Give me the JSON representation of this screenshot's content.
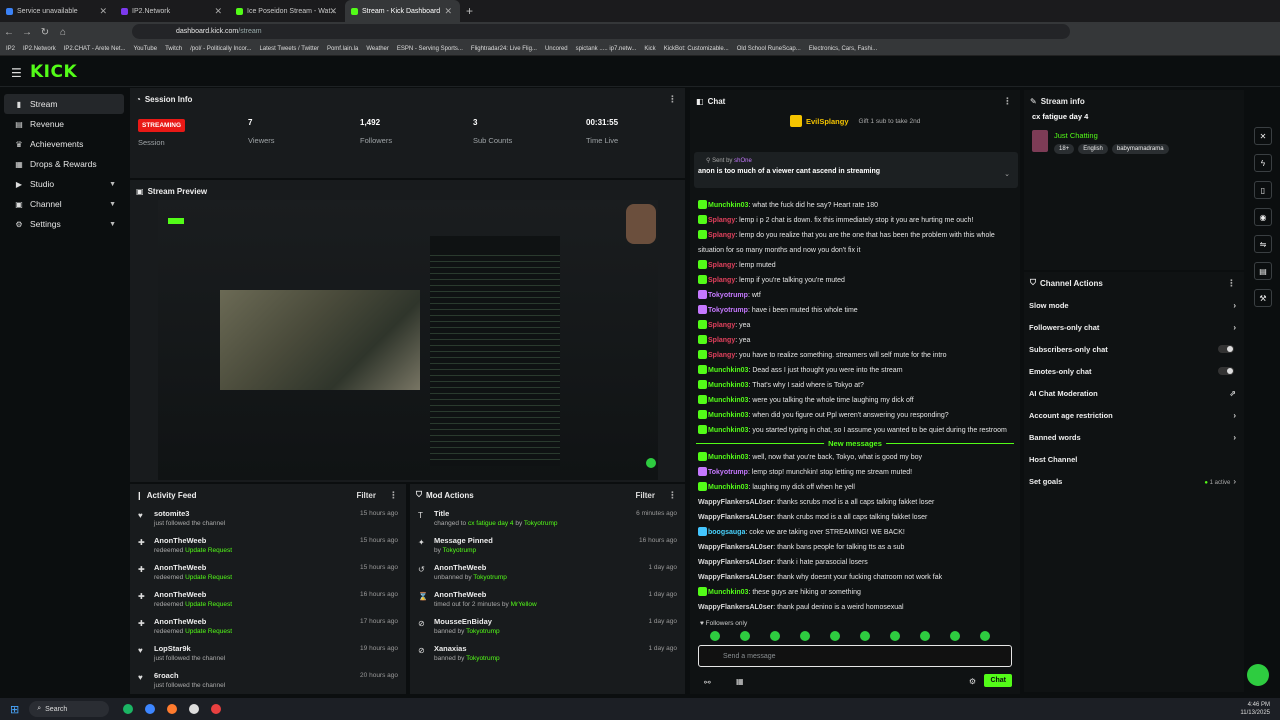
{
  "browser": {
    "tabs": [
      {
        "label": "Service unavailable",
        "color": "#3b82f6"
      },
      {
        "label": "IP2.Network",
        "color": "#7c3aed"
      },
      {
        "label": "Ice Poseidon Stream - Wat...",
        "color": "#53fc18"
      },
      {
        "label": "Stream - Kick Dashboard",
        "color": "#53fc18"
      }
    ],
    "url_domain": "dashboard.kick.com",
    "url_path": "/stream",
    "bookmarks": [
      "IP2",
      "IP2.Network",
      "IP2.CHAT - Arete Net...",
      "YouTube",
      "Twitch",
      "/pol/ - Politically Incor...",
      "Latest Tweets / Twitter",
      "Pomf.lain.la",
      "Weather",
      "ESPN - Serving Sports...",
      "Flightradar24: Live Flig...",
      "Uncored",
      "spictank ..... ip7.netw...",
      "Kick",
      "KickBot: Customizable...",
      "Old School RuneScap...",
      "Electronics, Cars, Fashi..."
    ]
  },
  "app": {
    "logo": "KICK"
  },
  "sidebar": {
    "items": [
      {
        "label": "Stream",
        "icon": "stream-icon",
        "active": true
      },
      {
        "label": "Revenue",
        "icon": "revenue-icon"
      },
      {
        "label": "Achievements",
        "icon": "trophy-icon"
      },
      {
        "label": "Drops & Rewards",
        "icon": "gift-icon"
      },
      {
        "label": "Studio",
        "icon": "studio-icon",
        "expand": true
      },
      {
        "label": "Channel",
        "icon": "channel-icon",
        "expand": true
      },
      {
        "label": "Settings",
        "icon": "gear-icon",
        "expand": true
      }
    ]
  },
  "session": {
    "title": "Session Info",
    "status": "STREAMING",
    "status_label": "Session",
    "viewers": "7",
    "viewers_label": "Viewers",
    "followers": "1,492",
    "followers_label": "Followers",
    "subs": "3",
    "subs_label": "Sub Counts",
    "time": "00:31:55",
    "time_label": "Time Live"
  },
  "preview": {
    "title": "Stream Preview"
  },
  "activity": {
    "title": "Activity Feed",
    "filter": "Filter",
    "rows": [
      {
        "name": "sotomite3",
        "text": "just followed the channel",
        "link": "",
        "time": "15 hours ago",
        "icon": "heart-icon"
      },
      {
        "name": "AnonTheWeeb",
        "text": "redeemed",
        "link": "Update Request",
        "time": "15 hours ago",
        "icon": "redeem-icon"
      },
      {
        "name": "AnonTheWeeb",
        "text": "redeemed",
        "link": "Update Request",
        "time": "15 hours ago",
        "icon": "redeem-icon"
      },
      {
        "name": "AnonTheWeeb",
        "text": "redeemed",
        "link": "Update Request",
        "time": "16 hours ago",
        "icon": "redeem-icon"
      },
      {
        "name": "AnonTheWeeb",
        "text": "redeemed",
        "link": "Update Request",
        "time": "17 hours ago",
        "icon": "redeem-icon"
      },
      {
        "name": "LopStar9k",
        "text": "just followed the channel",
        "link": "",
        "time": "19 hours ago",
        "icon": "heart-icon"
      },
      {
        "name": "6roach",
        "text": "just followed the channel",
        "link": "",
        "time": "20 hours ago",
        "icon": "heart-icon"
      }
    ]
  },
  "mod": {
    "title": "Mod Actions",
    "filter": "Filter",
    "rows": [
      {
        "name": "Title",
        "pre": "changed to",
        "mid": "cx fatigue day 4",
        "by": "by",
        "link": "Tokyotrump",
        "time": "6 minutes ago",
        "icon": "title-icon"
      },
      {
        "name": "Message Pinned",
        "pre": "by",
        "mid": "",
        "by": "",
        "link": "Tokyotrump",
        "time": "16 hours ago",
        "icon": "pin-icon"
      },
      {
        "name": "AnonTheWeeb",
        "pre": "unbanned by",
        "mid": "",
        "by": "",
        "link": "Tokyotrump",
        "time": "1 day ago",
        "icon": "unban-icon"
      },
      {
        "name": "AnonTheWeeb",
        "pre": "timed out for 2 minutes by",
        "mid": "",
        "by": "",
        "link": "MrYellow",
        "time": "1 day ago",
        "icon": "timeout-icon"
      },
      {
        "name": "MousseEnBiday",
        "pre": "banned by",
        "mid": "",
        "by": "",
        "link": "Tokyotrump",
        "time": "1 day ago",
        "icon": "ban-icon"
      },
      {
        "name": "Xanaxias",
        "pre": "banned by",
        "mid": "",
        "by": "",
        "link": "Tokyotrump",
        "time": "1 day ago",
        "icon": "ban-icon"
      }
    ]
  },
  "chat": {
    "title": "Chat",
    "gifter": "EvilSplangy",
    "gift_text": "Gift 1 sub to take 2nd",
    "pinned_by_label": "Sent by",
    "pinned_by": "shOne",
    "pinned_text": "anon is too much of a viewer cant ascend in streaming",
    "new_messages": "New messages",
    "followers_only": "Followers only",
    "placeholder": "Send a message",
    "send_label": "Chat",
    "messages_before": [
      {
        "user": "Munchkin03",
        "cls": "g",
        "text": "what the fuck did he say? Heart rate 180",
        "badge": "bd"
      },
      {
        "user": "Splangy",
        "cls": "r",
        "text": "lemp i p 2 chat is down. fix this immediately stop it you are hurting me ouch!",
        "badge": "bd"
      },
      {
        "user": "Splangy",
        "cls": "r",
        "text": "lemp do you realize that you are the one that has been the problem with this whole",
        "badge": "bd"
      },
      {
        "user": "",
        "cls": "w",
        "text": "situation for so many months and now you don't fix it",
        "badge": ""
      },
      {
        "user": "Splangy",
        "cls": "r",
        "text": "lemp muted",
        "badge": "bd"
      },
      {
        "user": "Splangy",
        "cls": "r",
        "text": "lemp if you're talking you're muted",
        "badge": "bd"
      },
      {
        "user": "Tokyotrump",
        "cls": "p",
        "text": "wtf",
        "badge": "bp"
      },
      {
        "user": "Tokyotrump",
        "cls": "p",
        "text": "have i been muted this whole time",
        "badge": "bp"
      },
      {
        "user": "Splangy",
        "cls": "r",
        "text": "yea",
        "badge": "bd"
      },
      {
        "user": "Splangy",
        "cls": "r",
        "text": "yea",
        "badge": "bd"
      },
      {
        "user": "Splangy",
        "cls": "r",
        "text": "you have to realize something. streamers will self mute for the intro",
        "badge": "bd"
      },
      {
        "user": "Munchkin03",
        "cls": "g",
        "text": "Dead ass I just thought you were into the stream",
        "badge": "bd"
      },
      {
        "user": "Munchkin03",
        "cls": "g",
        "text": "That's why I said where is Tokyo at?",
        "badge": "bd"
      },
      {
        "user": "Munchkin03",
        "cls": "g",
        "text": "were you talking the whole time laughing my dick off",
        "badge": "bd"
      },
      {
        "user": "Munchkin03",
        "cls": "g",
        "text": "when did you figure out Ppl weren't answering you responding?",
        "badge": "bd"
      },
      {
        "user": "Munchkin03",
        "cls": "g",
        "text": "you started typing in chat, so I assume you wanted to be quiet during the restroom",
        "badge": "bd"
      }
    ],
    "messages_after": [
      {
        "user": "Munchkin03",
        "cls": "g",
        "text": "well, now that you're back, Tokyo, what is good my boy",
        "badge": "bd"
      },
      {
        "user": "Tokyotrump",
        "cls": "p",
        "text": "lemp stop! munchkin! stop letting me stream muted!",
        "badge": "bp"
      },
      {
        "user": "Munchkin03",
        "cls": "g",
        "text": "laughing my dick off when he yell",
        "badge": "bd"
      },
      {
        "user": "WappyFlankersAL0ser",
        "cls": "w",
        "text": "thanks scrubs mod is a all caps talking fakket loser",
        "badge": ""
      },
      {
        "user": "WappyFlankersAL0ser",
        "cls": "w",
        "text": "thank crubs mod is a all caps talking fakket loser",
        "badge": ""
      },
      {
        "user": "boogsauga",
        "cls": "c",
        "text": "coke we are taking over STREAMING! WE BACK!",
        "badge": "bx"
      },
      {
        "user": "WappyFlankersAL0ser",
        "cls": "w",
        "text": "thank bans people for talking tts as a sub",
        "badge": ""
      },
      {
        "user": "WappyFlankersAL0ser",
        "cls": "w",
        "text": "thank i hate parasocial losers",
        "badge": ""
      },
      {
        "user": "WappyFlankersAL0ser",
        "cls": "w",
        "text": "thank why doesnt your fucking chatroom not work fak",
        "badge": ""
      },
      {
        "user": "Munchkin03",
        "cls": "g",
        "text": "these guys are hiking or something",
        "badge": "bd"
      },
      {
        "user": "WappyFlankersAL0ser",
        "cls": "w",
        "text": "thank paul denino is a weird homosexual",
        "badge": ""
      }
    ]
  },
  "stream_info": {
    "title": "Stream info",
    "stream_title": "cx fatigue day 4",
    "category": "Just Chatting",
    "tags": [
      "18+",
      "English",
      "babymamadrama"
    ]
  },
  "channel_actions": {
    "title": "Channel Actions",
    "items": [
      {
        "label": "Slow mode",
        "kind": "arrow"
      },
      {
        "label": "Followers-only chat",
        "kind": "arrow"
      },
      {
        "label": "Subscribers-only chat",
        "kind": "toggle"
      },
      {
        "label": "Emotes-only chat",
        "kind": "toggle"
      },
      {
        "label": "AI Chat Moderation",
        "kind": "ext"
      },
      {
        "label": "Account age restriction",
        "kind": "arrow"
      },
      {
        "label": "Banned words",
        "kind": "arrow"
      },
      {
        "label": "Host Channel",
        "kind": "none"
      },
      {
        "label": "Set goals",
        "kind": "active",
        "extra": "1 active"
      }
    ]
  },
  "taskbar": {
    "search": "Search",
    "time": "4:46 PM",
    "date": "11/13/2025"
  }
}
